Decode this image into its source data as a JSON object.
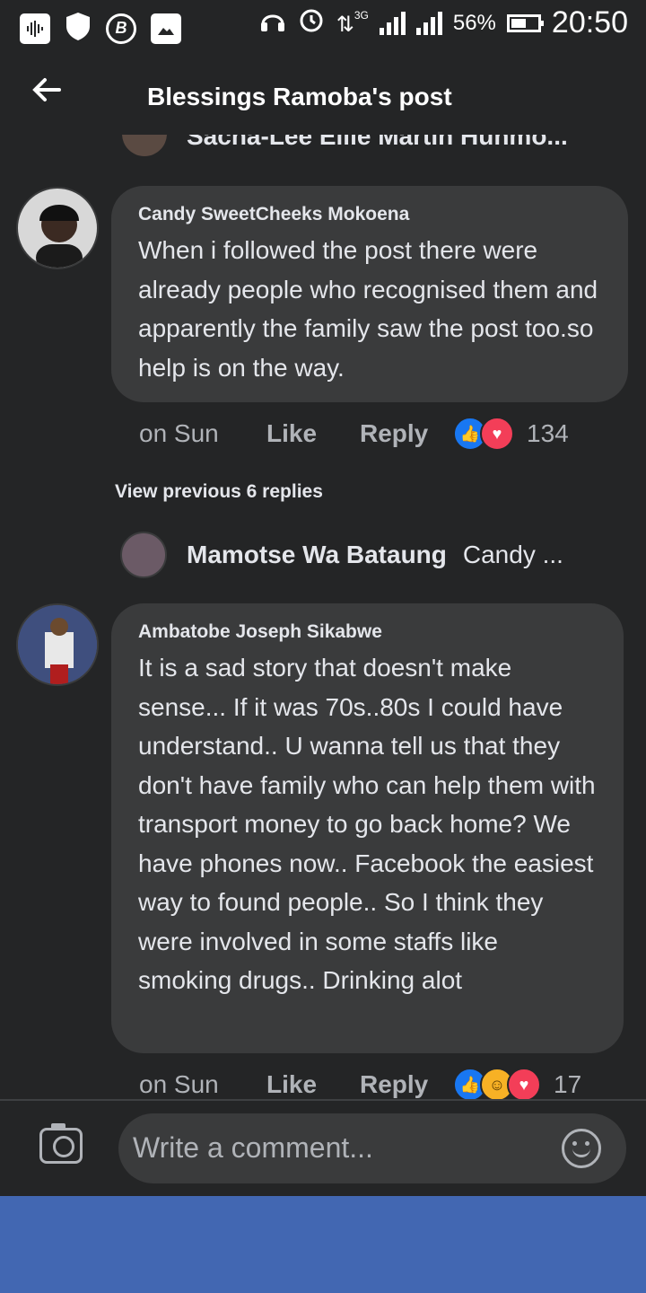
{
  "status_bar": {
    "time": "20:50",
    "battery_percent": "56%",
    "network": "3G",
    "left_icons": [
      "waveform-icon",
      "shield-icon",
      "b-circle-icon",
      "image-icon"
    ],
    "right_icons": [
      "headphones-icon",
      "alarm-icon",
      "data-arrows-icon",
      "signal-icon",
      "signal-icon",
      "battery-icon"
    ],
    "battery_level": 0.56
  },
  "header": {
    "title": "Blessings Ramoba's post",
    "back_icon": "back-arrow-icon"
  },
  "cutoff_comment": {
    "name_partial": "Sacha-Lee Ellie Martin  Hunmo..."
  },
  "comments": [
    {
      "author": "Candy SweetCheeks Mokoena",
      "text": "When i followed the post there were already people who recognised them and apparently the family saw the post too.so help is on the way.",
      "time": "on Sun",
      "like_label": "Like",
      "reply_label": "Reply",
      "reactions": [
        "like",
        "love"
      ],
      "reaction_count": "134"
    },
    {
      "author": "Ambatobe Joseph Sikabwe",
      "text": "It is a sad story that doesn't make sense... If it was 70s..80s I could have understand.. U wanna tell us that they don't have family who can help them with transport money to go back home? We have phones now.. Facebook the easiest way to found people.. So I think they were involved in some staffs like smoking drugs.. Drinking alot",
      "time": "on Sun",
      "like_label": "Like",
      "reply_label": "Reply",
      "reactions": [
        "like",
        "haha",
        "love"
      ],
      "reaction_count": "17"
    }
  ],
  "view_previous": "View previous 6 replies",
  "reply_preview": {
    "name": "Mamotse Wa Bataung",
    "text": "Candy ..."
  },
  "composer": {
    "placeholder": "Write a comment...",
    "camera_icon": "camera-icon",
    "emoji_icon": "smiley-icon"
  },
  "colors": {
    "background": "#242526",
    "bubble": "#3a3b3c",
    "nav_bar": "#4267b2",
    "like_blue": "#1877f2",
    "love_red": "#f33e58"
  }
}
